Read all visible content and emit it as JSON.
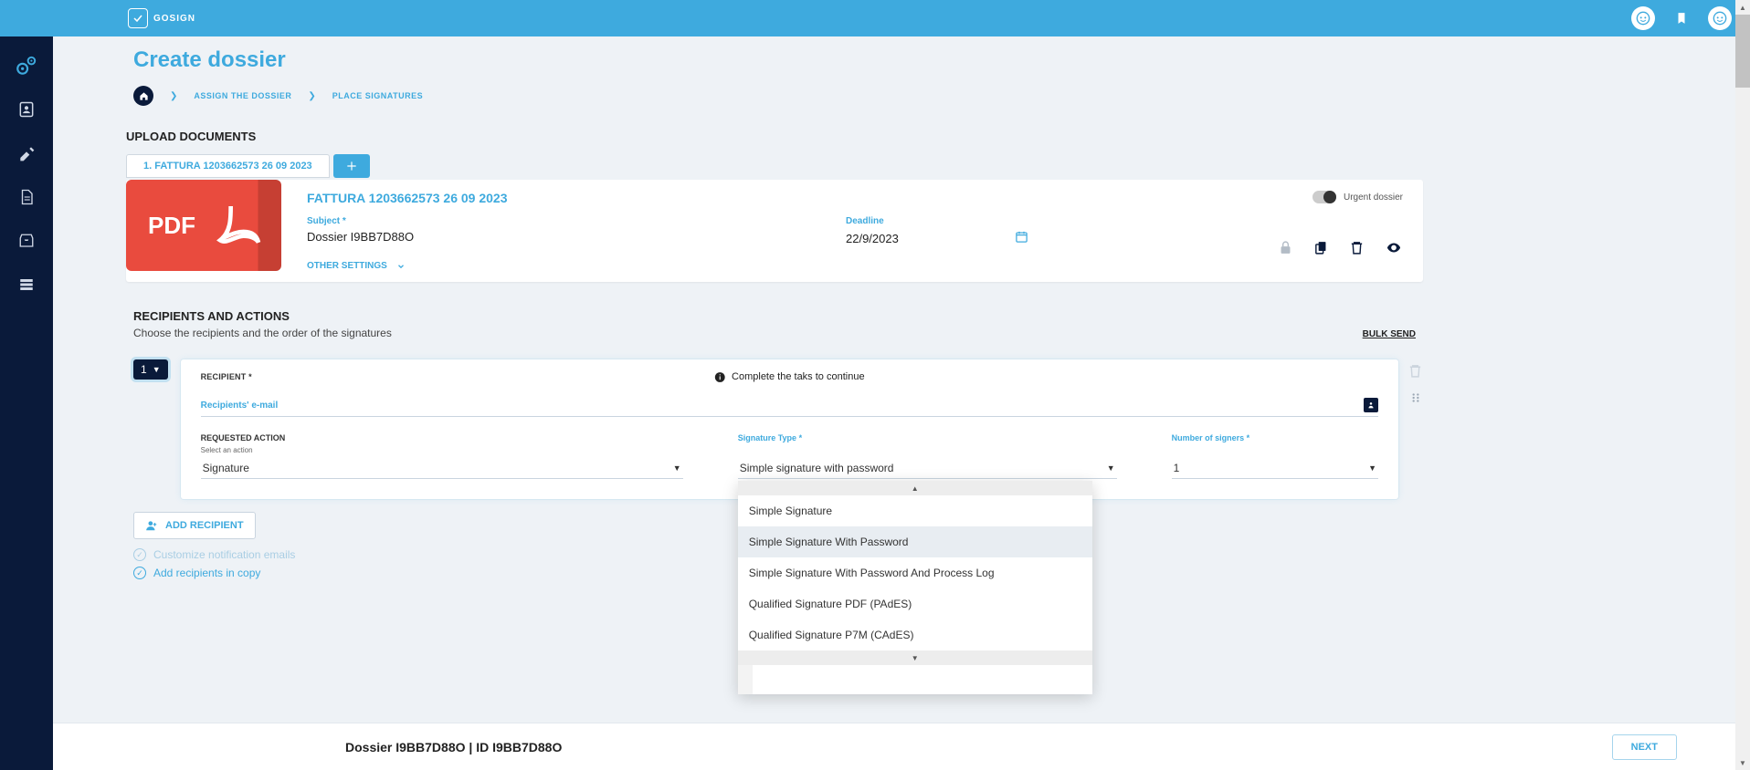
{
  "brand": "GOSIGN",
  "page_title": "Create dossier",
  "breadcrumb": {
    "step1": "ASSIGN THE DOSSIER",
    "step2": "PLACE SIGNATURES"
  },
  "upload": {
    "heading": "UPLOAD DOCUMENTS",
    "tab": {
      "label": "1. FATTURA 1203662573 26 09 2023"
    },
    "doc": {
      "title": "FATTURA 1203662573 26 09 2023",
      "subject_label": "Subject *",
      "subject_value": "Dossier I9BB7D88O",
      "deadline_label": "Deadline",
      "deadline_value": "22/9/2023",
      "other_settings": "OTHER SETTINGS",
      "urgent_label": "Urgent dossier",
      "pdf_badge": "PDF"
    }
  },
  "recipients": {
    "heading": "RECIPIENTS AND ACTIONS",
    "sub": "Choose the recipients and the order of the signatures",
    "bulk": "BULK SEND",
    "step_number": "1",
    "card": {
      "recipient_label": "RECIPIENT *",
      "task_message": "Complete the taks to continue",
      "email_placeholder": "Recipients' e-mail",
      "requested_action_label": "REQUESTED ACTION",
      "select_action_sub": "Select an action",
      "requested_action_value": "Signature",
      "signature_type_label": "Signature Type *",
      "signature_type_value": "Simple signature with password",
      "number_signers_label": "Number of signers *",
      "number_signers_value": "1"
    },
    "dropdown_options": [
      "Simple Signature",
      "Simple Signature With Password",
      "Simple Signature With Password And Process Log",
      "Qualified Signature PDF (PAdES)",
      "Qualified Signature P7M (CAdES)"
    ],
    "add_recipient": "ADD RECIPIENT",
    "opt_customize": "Customize notification emails",
    "opt_add_cc": "Add recipients in copy"
  },
  "footer": {
    "text": "Dossier I9BB7D88O | ID I9BB7D88O",
    "next": "NEXT"
  }
}
